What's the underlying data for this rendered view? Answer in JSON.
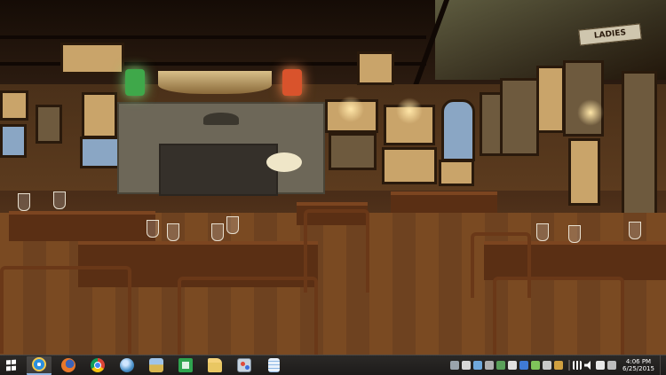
{
  "wallpaper": {
    "sign_text": "LADIES"
  },
  "taskbar": {
    "start": {
      "icon": "windows-logo-icon"
    },
    "pinned": [
      {
        "name": "internet-explorer",
        "icon": "internet-explorer-icon",
        "active": true,
        "color": "#2a8fe0"
      },
      {
        "name": "firefox",
        "icon": "firefox-icon",
        "active": false,
        "color": "#e8772a"
      },
      {
        "name": "chrome",
        "icon": "chrome-icon",
        "active": false,
        "color": "#3aa655"
      },
      {
        "name": "network-globe",
        "icon": "globe-icon",
        "active": false,
        "color": "#4a90c8"
      },
      {
        "name": "folder-app",
        "icon": "folder-picture-icon",
        "active": false,
        "color": "#d8b650"
      },
      {
        "name": "store",
        "icon": "store-icon",
        "active": false,
        "color": "#2fa44f"
      },
      {
        "name": "file-explorer",
        "icon": "folder-icon",
        "active": false,
        "color": "#e9c763"
      },
      {
        "name": "paint",
        "icon": "paint-icon",
        "active": false,
        "color": "#c8d4e0"
      },
      {
        "name": "notepad",
        "icon": "notepad-icon",
        "active": false,
        "color": "#8fb8e4"
      }
    ],
    "tray_icons": [
      "tray-app-icon-1",
      "tray-app-icon-2",
      "tray-app-icon-3",
      "tray-app-icon-4",
      "tray-app-icon-5",
      "tray-app-icon-6",
      "tray-app-icon-7",
      "tray-app-icon-8",
      "tray-app-icon-9",
      "tray-app-icon-10",
      "network-icon",
      "volume-icon",
      "action-center-icon",
      "keyboard-icon"
    ],
    "clock": {
      "time": "4:06 PM",
      "date": "6/25/2015"
    }
  }
}
